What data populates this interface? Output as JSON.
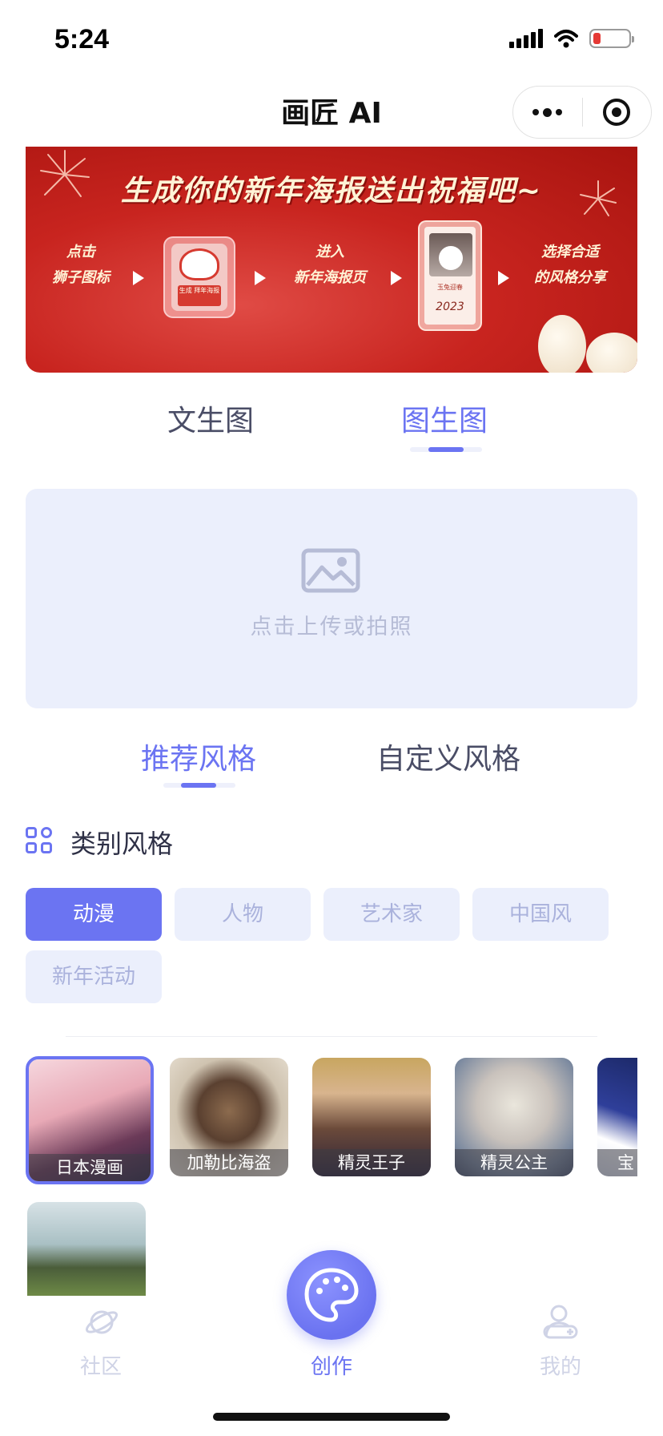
{
  "status_bar": {
    "time": "5:24"
  },
  "nav": {
    "title": "画匠 AI"
  },
  "banner": {
    "headline": "生成你的新年海报送出祝福吧~",
    "step1": [
      "点击",
      "狮子图标"
    ],
    "step2": [
      "进入",
      "新年海报页"
    ],
    "step3": [
      "选择合适",
      "的风格分享"
    ],
    "lion_tag": "生成 拜年海报",
    "poster_caption": "玉兔迎春"
  },
  "main_tabs": [
    {
      "label": "文生图",
      "active": false
    },
    {
      "label": "图生图",
      "active": true
    }
  ],
  "upload": {
    "hint": "点击上传或拍照"
  },
  "style_tabs": [
    {
      "label": "推荐风格",
      "active": true
    },
    {
      "label": "自定义风格",
      "active": false
    }
  ],
  "category_section": {
    "title": "类别风格",
    "chips": [
      {
        "label": "动漫",
        "active": true
      },
      {
        "label": "人物",
        "active": false
      },
      {
        "label": "艺术家",
        "active": false
      },
      {
        "label": "中国风",
        "active": false
      },
      {
        "label": "新年活动",
        "active": false
      }
    ]
  },
  "style_cards": [
    {
      "label": "日本漫画",
      "selected": true
    },
    {
      "label": "加勒比海盗",
      "selected": false
    },
    {
      "label": "精灵王子",
      "selected": false
    },
    {
      "label": "精灵公主",
      "selected": false
    },
    {
      "label": "宝",
      "selected": false
    },
    {
      "label": "",
      "selected": false
    }
  ],
  "bottom_nav": {
    "community": "社区",
    "create": "创作",
    "mine": "我的"
  },
  "colors": {
    "accent": "#6b74f2",
    "chip_bg": "#ebeffc",
    "banner_red": "#c8241f"
  }
}
